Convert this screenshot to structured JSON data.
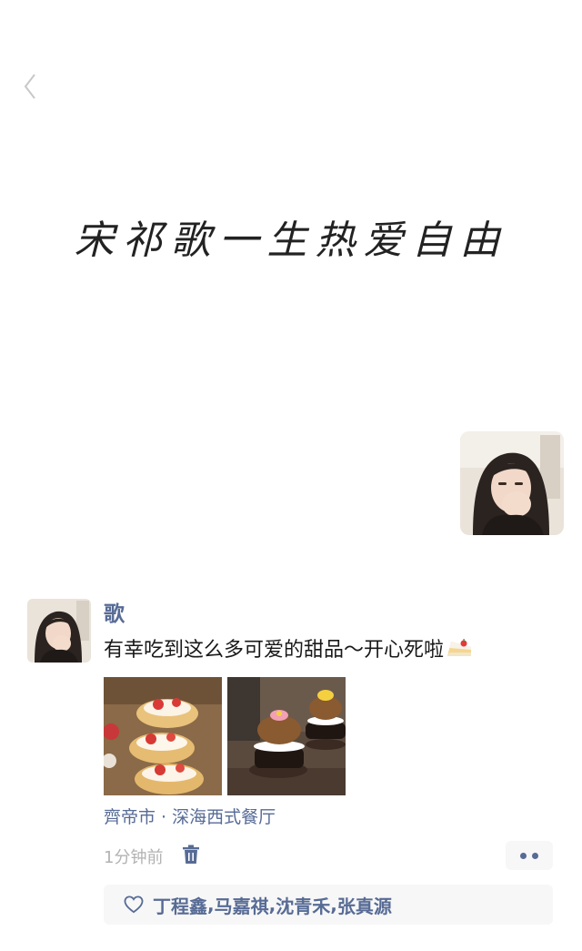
{
  "header": {
    "back_icon": "chevron-left-icon"
  },
  "cover": {
    "text": "宋祁歌一生热爱自由"
  },
  "post": {
    "username": "歌",
    "text": "有幸吃到这么多可爱的甜品～开心死啦",
    "emoji": "cake-slice-icon",
    "photos": [
      "strawberry-cream-puffs-photo",
      "choux-dessert-towers-photo"
    ],
    "location": "齊帝市 · 深海西式餐厅",
    "timestamp": "1分钟前",
    "delete_icon": "trash-icon",
    "more_icon": "more-dots-icon",
    "likes": {
      "icon": "heart-outline-icon",
      "names": [
        "丁程鑫",
        "马嘉祺",
        "沈青禾",
        "张真源"
      ],
      "separator": ", "
    }
  },
  "colors": {
    "link": "#576b95",
    "text": "#191919",
    "muted": "#b2b2b2",
    "panel": "#f7f7f7"
  }
}
